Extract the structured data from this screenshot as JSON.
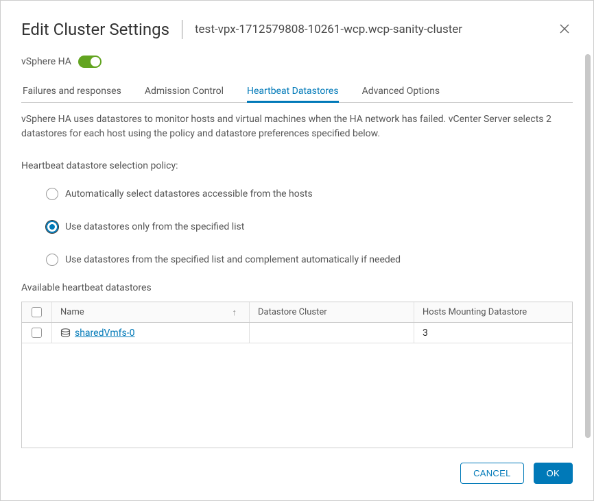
{
  "header": {
    "title": "Edit Cluster Settings",
    "subtitle": "test-vpx-1712579808-10261-wcp.wcp-sanity-cluster"
  },
  "toggle": {
    "label": "vSphere HA",
    "on": true
  },
  "tabs": [
    {
      "label": "Failures and responses",
      "active": false
    },
    {
      "label": "Admission Control",
      "active": false
    },
    {
      "label": "Heartbeat Datastores",
      "active": true
    },
    {
      "label": "Advanced Options",
      "active": false
    }
  ],
  "description": "vSphere HA uses datastores to monitor hosts and virtual machines when the HA network has failed. vCenter Server selects 2 datastores for each host using the policy and datastore preferences specified below.",
  "policy": {
    "label": "Heartbeat datastore selection policy:",
    "options": [
      {
        "label": "Automatically select datastores accessible from the hosts",
        "selected": false
      },
      {
        "label": "Use datastores only from the specified list",
        "selected": true
      },
      {
        "label": "Use datastores from the specified list and complement automatically if needed",
        "selected": false
      }
    ]
  },
  "table": {
    "caption": "Available heartbeat datastores",
    "columns": {
      "name": "Name",
      "cluster": "Datastore Cluster",
      "hosts": "Hosts Mounting Datastore"
    },
    "rows": [
      {
        "name": "sharedVmfs-0",
        "cluster": "",
        "hosts": "3",
        "checked": false
      }
    ]
  },
  "footer": {
    "cancel": "CANCEL",
    "ok": "OK"
  }
}
